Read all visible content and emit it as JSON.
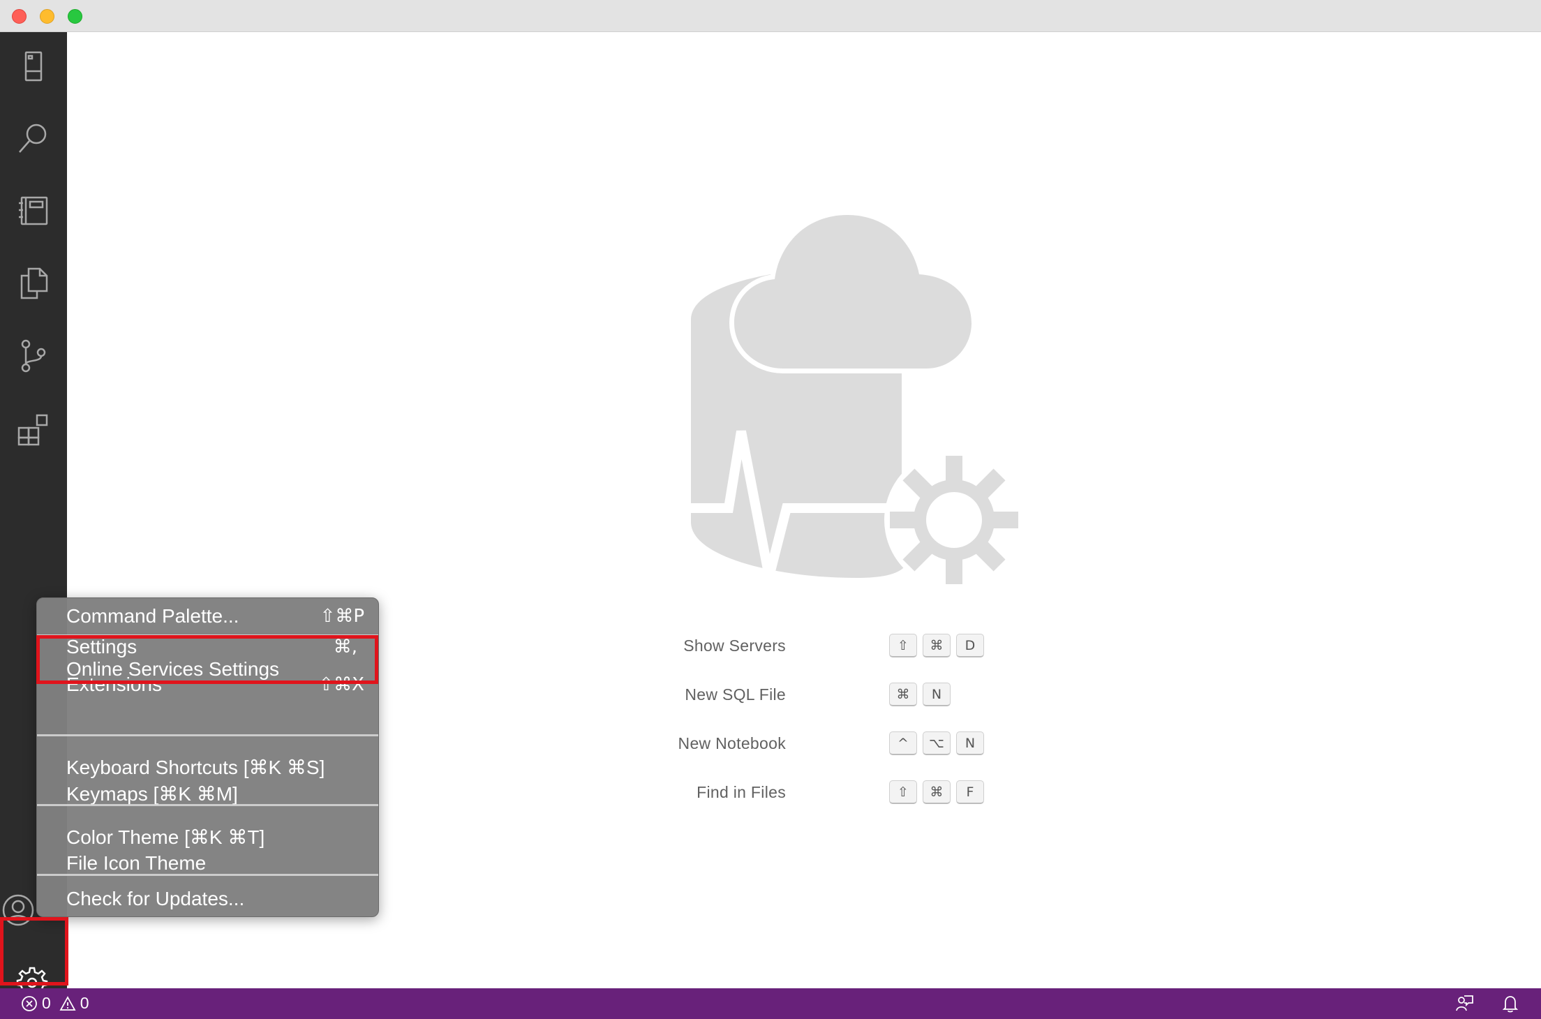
{
  "window": {
    "controls": [
      "close",
      "minimize",
      "zoom"
    ]
  },
  "activity_bar": {
    "items": [
      {
        "icon": "server-icon"
      },
      {
        "icon": "search-icon"
      },
      {
        "icon": "notebook-icon"
      },
      {
        "icon": "files-icon"
      },
      {
        "icon": "source-control-icon"
      },
      {
        "icon": "extensions-icon"
      },
      {
        "icon": "account-icon"
      },
      {
        "icon": "gear-icon"
      }
    ]
  },
  "welcome": {
    "hints": [
      {
        "label": "Show Servers",
        "keys": [
          "⇧",
          "⌘",
          "D"
        ]
      },
      {
        "label": "New SQL File",
        "keys": [
          "⌘",
          "N"
        ]
      },
      {
        "label": "New Notebook",
        "keys": [
          "^",
          "⌥",
          "N"
        ]
      },
      {
        "label": "Find in Files",
        "keys": [
          "⇧",
          "⌘",
          "F"
        ]
      }
    ]
  },
  "manage_menu": {
    "items": [
      {
        "label": "Command Palette...",
        "shortcut": "⇧⌘P"
      },
      {
        "label": "Settings",
        "shortcut": "⌘,"
      },
      {
        "label": "Online Services Settings",
        "shortcut": ""
      },
      {
        "label": "Extensions",
        "shortcut": "⇧⌘X"
      },
      {
        "label": "Keyboard Shortcuts [⌘K ⌘S]",
        "shortcut": ""
      },
      {
        "label": "Keymaps [⌘K ⌘M]",
        "shortcut": ""
      },
      {
        "label": "Color Theme [⌘K ⌘T]",
        "shortcut": ""
      },
      {
        "label": "File Icon Theme",
        "shortcut": ""
      },
      {
        "label": "Check for Updates...",
        "shortcut": ""
      }
    ]
  },
  "status_bar": {
    "errors": "0",
    "warnings": "0",
    "color": "#68217a"
  },
  "colors": {
    "highlight": "#e0141c"
  }
}
